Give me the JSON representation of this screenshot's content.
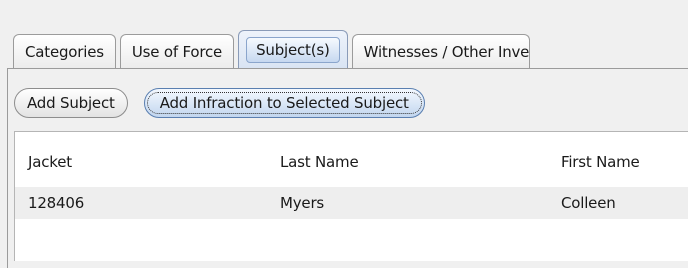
{
  "tabs": [
    {
      "label": "Categories",
      "active": false
    },
    {
      "label": "Use of Force",
      "active": false
    },
    {
      "label": "Subject(s)",
      "active": true
    },
    {
      "label": "Witnesses / Other Inve",
      "active": false
    }
  ],
  "toolbar": {
    "add_subject_label": "Add Subject",
    "add_infraction_label": "Add Infraction to Selected Subject"
  },
  "table": {
    "columns": [
      "Jacket",
      "Last Name",
      "First Name"
    ],
    "rows": [
      {
        "jacket": "128406",
        "last_name": "Myers",
        "first_name": "Colleen"
      }
    ]
  }
}
